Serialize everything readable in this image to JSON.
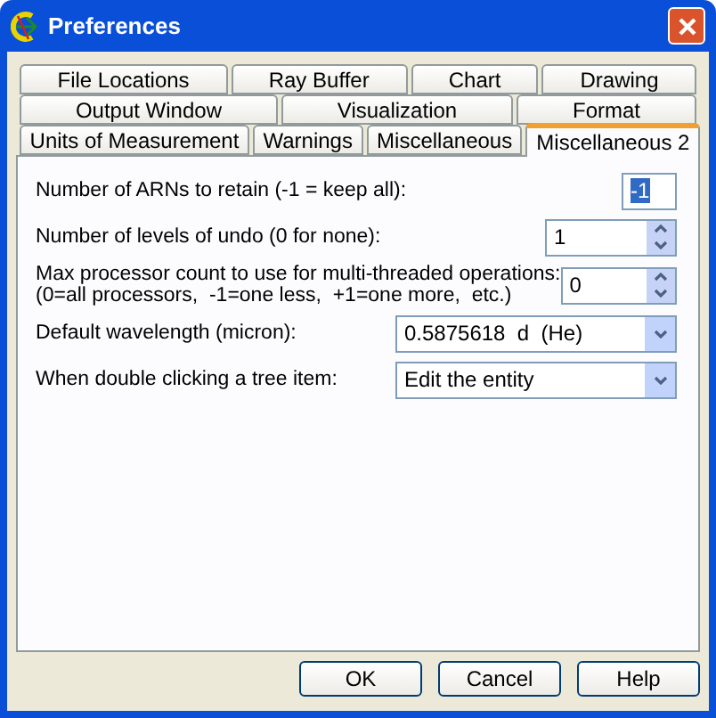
{
  "window": {
    "title": "Preferences"
  },
  "tab_rows": [
    [
      {
        "label": "File Locations",
        "selected": false
      },
      {
        "label": "Ray Buffer",
        "selected": false
      },
      {
        "label": "Chart",
        "selected": false
      },
      {
        "label": "Drawing",
        "selected": false
      }
    ],
    [
      {
        "label": "Output Window",
        "selected": false
      },
      {
        "label": "Visualization",
        "selected": false
      },
      {
        "label": "Format",
        "selected": false
      }
    ],
    [
      {
        "label": "Units of Measurement",
        "selected": false
      },
      {
        "label": "Warnings",
        "selected": false
      },
      {
        "label": "Miscellaneous",
        "selected": false
      },
      {
        "label": "Miscellaneous 2",
        "selected": true
      }
    ]
  ],
  "settings": [
    {
      "kind": "text",
      "label": "Number of ARNs to retain (-1 = keep all):",
      "value": "-1",
      "highlighted": true
    },
    {
      "kind": "spinner",
      "label": "Number of levels of undo (0 for none):",
      "value": "1"
    },
    {
      "kind": "spinner",
      "label": "Max processor count to use for multi-threaded operations:\n(0=all processors,  -1=one less,  +1=one more,  etc.)",
      "value": "0"
    },
    {
      "kind": "dropdown",
      "label": "Default wavelength (micron):",
      "value": "0.5875618  d  (He)"
    },
    {
      "kind": "dropdown",
      "label": "When double clicking a tree item:",
      "value": "Edit the entity"
    }
  ],
  "buttons": [
    "OK",
    "Cancel",
    "Help"
  ]
}
